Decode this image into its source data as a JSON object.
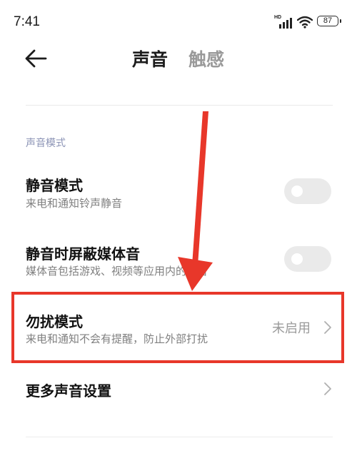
{
  "status_bar": {
    "time": "7:41",
    "network_label": "HD",
    "battery": "87"
  },
  "header": {
    "tabs": [
      {
        "label": "声音",
        "active": true
      },
      {
        "label": "触感",
        "active": false
      }
    ]
  },
  "section": {
    "label": "声音模式"
  },
  "items": [
    {
      "title": "静音模式",
      "subtitle": "来电和通知铃声静音",
      "control": "toggle",
      "on": false
    },
    {
      "title": "静音时屏蔽媒体音",
      "subtitle": "媒体音包括游戏、视频等应用内的声音",
      "control": "toggle",
      "on": false
    },
    {
      "title": "勿扰模式",
      "subtitle": "来电和通知不会有提醒，防止外部打扰",
      "control": "link",
      "value": "未启用"
    },
    {
      "title": "更多声音设置",
      "control": "link"
    }
  ],
  "colors": {
    "annotation": "#e8372a",
    "section_label": "#8b93b5",
    "toggle_off": "#eaeaea"
  }
}
